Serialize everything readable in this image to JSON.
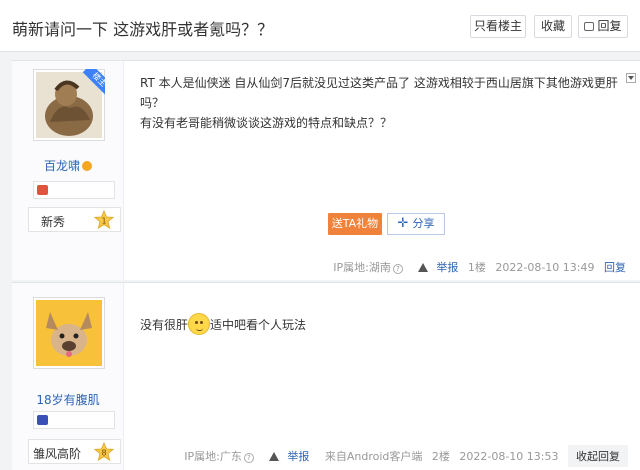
{
  "thread": {
    "title": "萌新请问一下 这游戏肝或者氪吗？？",
    "buttons": {
      "only_owner": "只看楼主",
      "favorite": "收藏",
      "reply": "回复"
    }
  },
  "posts": [
    {
      "author": {
        "name": "百龙啸",
        "badge_owner": "楼主",
        "level_title": "新秀",
        "level_num": "1"
      },
      "lines": [
        "RT 本人是仙侠迷 自从仙剑7后就没见过这类产品了 这游戏相较于西山居旗下其他游戏更肝",
        "吗？",
        "有没有老哥能稍微谈谈这游戏的特点和缺点？？"
      ],
      "gift_label": "送TA礼物",
      "share_label": "分享",
      "meta": {
        "ip": "IP属地:湖南",
        "report": "举报",
        "floor": "1楼",
        "time": "2022-08-10 13:49",
        "reply": "回复"
      }
    },
    {
      "author": {
        "name": "18岁有腹肌",
        "level_title": "雏风高阶",
        "level_num": "8"
      },
      "text_before": "没有很肝",
      "text_after": "适中吧看个人玩法",
      "meta": {
        "ip": "IP属地:广东",
        "report": "举报",
        "client": "来自Android客户端",
        "floor": "2楼",
        "time": "2022-08-10 13:53",
        "fold_reply": "收起回复"
      }
    }
  ],
  "colors": {
    "link": "#2d64b3",
    "gift": "#f0823c",
    "owner_badge": "#3c82f6"
  },
  "icons": [
    "reply-icon",
    "collapse-icon",
    "warning-icon",
    "help-icon",
    "star-level-icon",
    "emoji-icon"
  ]
}
